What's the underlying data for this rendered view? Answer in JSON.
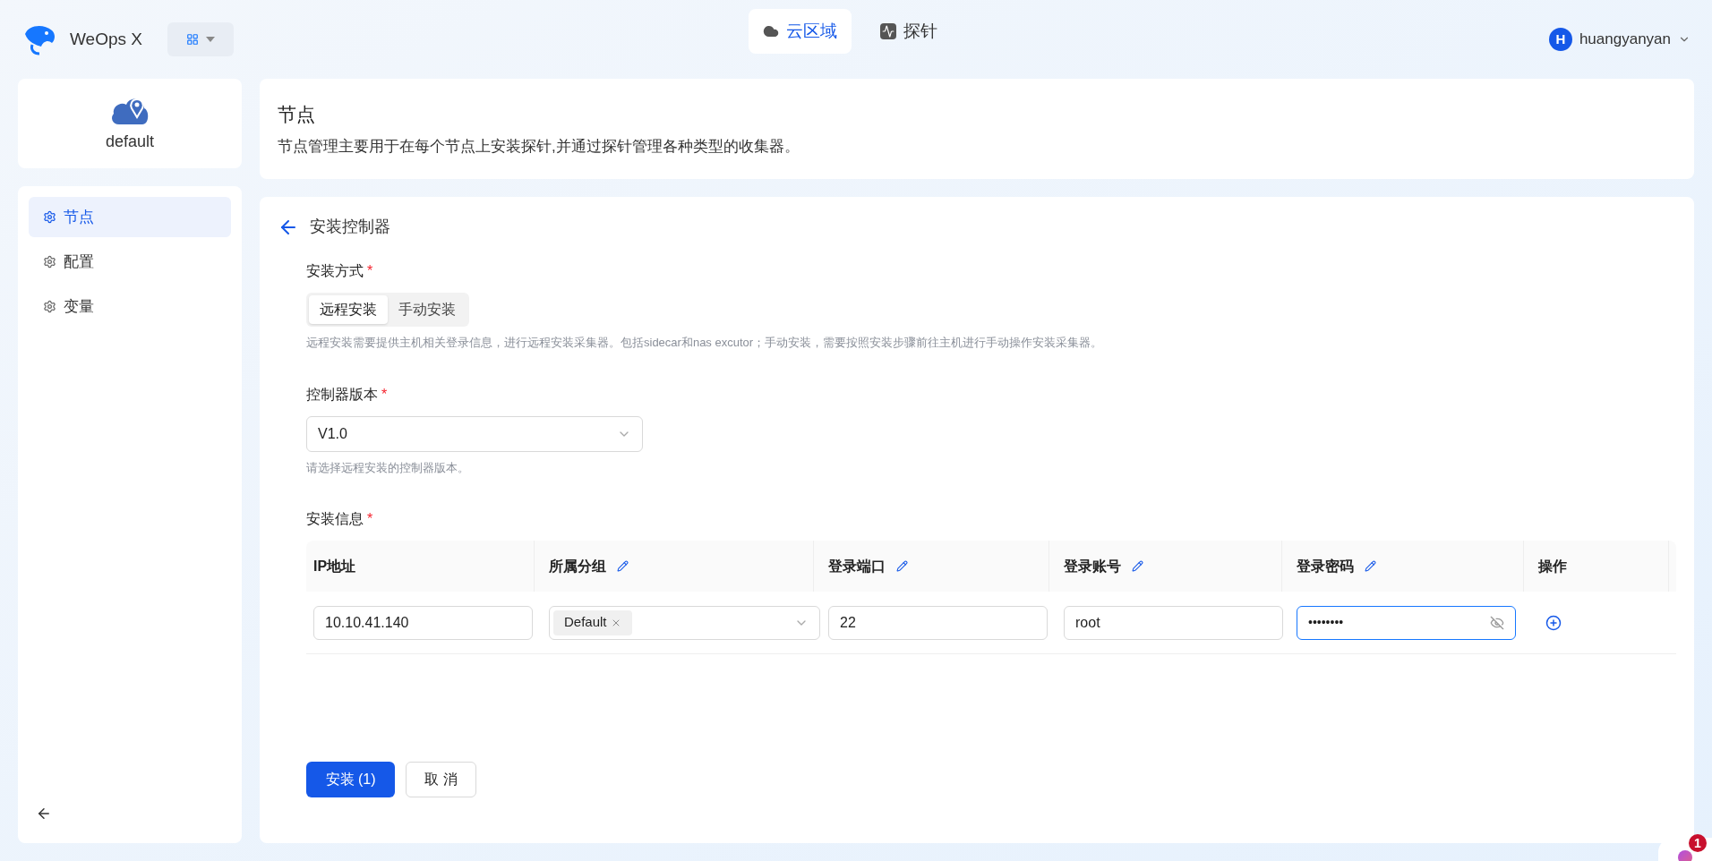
{
  "app": {
    "name": "WeOps X"
  },
  "top_tabs": [
    {
      "label": "云区域",
      "selected": true,
      "kind": "cloud"
    },
    {
      "label": "探针",
      "selected": false,
      "kind": "probe"
    }
  ],
  "user": {
    "initial": "H",
    "name": "huangyanyan"
  },
  "cloud": {
    "name": "default"
  },
  "sidebar": {
    "items": [
      {
        "label": "节点",
        "selected": true
      },
      {
        "label": "配置",
        "selected": false
      },
      {
        "label": "变量",
        "selected": false
      }
    ]
  },
  "header": {
    "title": "节点",
    "description": "节点管理主要用于在每个节点上安装探针,并通过探针管理各种类型的收集器。"
  },
  "form": {
    "title": "安装控制器",
    "method": {
      "label": "安装方式",
      "required_mark": "*",
      "options": [
        {
          "label": "远程安装",
          "selected": true
        },
        {
          "label": "手动安装",
          "selected": false
        }
      ],
      "help": "远程安装需要提供主机相关登录信息，进行远程安装采集器。包括sidecar和nas excutor；手动安装，需要按照安装步骤前往主机进行手动操作安装采集器。"
    },
    "version": {
      "label": "控制器版本",
      "required_mark": "*",
      "value": "V1.0",
      "help": "请选择远程安装的控制器版本。"
    },
    "info": {
      "label": "安装信息",
      "required_mark": "*"
    }
  },
  "table": {
    "columns": [
      {
        "label": "IP地址",
        "editable": false
      },
      {
        "label": "所属分组",
        "editable": true
      },
      {
        "label": "登录端口",
        "editable": true
      },
      {
        "label": "登录账号",
        "editable": true
      },
      {
        "label": "登录密码",
        "editable": true
      },
      {
        "label": "操作",
        "editable": false
      }
    ],
    "rows": [
      {
        "ip": "10.10.41.140",
        "group_tags": [
          "Default"
        ],
        "port": "22",
        "account": "root",
        "password": "••••••••"
      }
    ]
  },
  "buttons": [
    {
      "label": "安装 (1)",
      "kind": "primary"
    },
    {
      "label": "取 消",
      "kind": "default"
    }
  ],
  "assistant": {
    "badge": "1"
  }
}
